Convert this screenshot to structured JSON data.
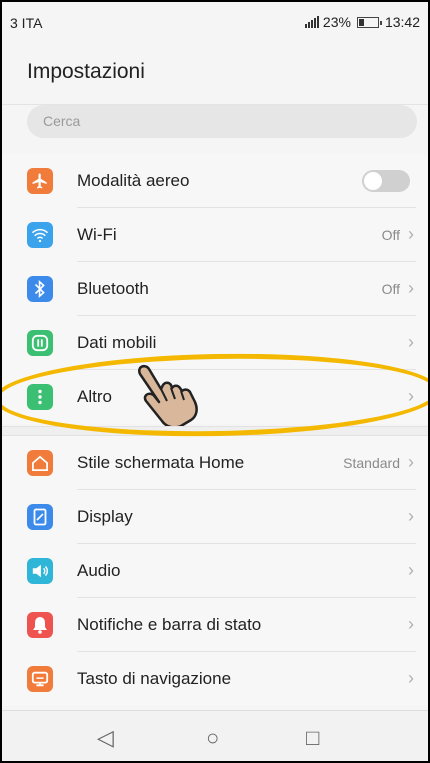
{
  "status_bar": {
    "carrier": "3 ITA",
    "battery": "23%",
    "time": "13:42"
  },
  "header": {
    "title": "Impostazioni"
  },
  "search": {
    "placeholder": "Cerca"
  },
  "groups": [
    {
      "items": [
        {
          "label": "Modalità aereo",
          "icon": "airplane-icon",
          "color": "#f07b3a",
          "control": "toggle",
          "toggle_on": false
        },
        {
          "label": "Wi-Fi",
          "icon": "wifi-icon",
          "color": "#3aa3ec",
          "value": "Off"
        },
        {
          "label": "Bluetooth",
          "icon": "bluetooth-icon",
          "color": "#3c8bea",
          "value": "Off"
        },
        {
          "label": "Dati mobili",
          "icon": "mobile-data-icon",
          "color": "#3bbf72",
          "value": ""
        },
        {
          "label": "Altro",
          "icon": "more-icon",
          "color": "#3bbf72",
          "value": ""
        }
      ]
    },
    {
      "items": [
        {
          "label": "Stile schermata Home",
          "icon": "home-icon",
          "color": "#f07b3a",
          "value": "Standard"
        },
        {
          "label": "Display",
          "icon": "display-icon",
          "color": "#3c8bea",
          "value": ""
        },
        {
          "label": "Audio",
          "icon": "audio-icon",
          "color": "#2fb5d8",
          "value": ""
        },
        {
          "label": "Notifiche e barra di stato",
          "icon": "notification-icon",
          "color": "#ef5350",
          "value": ""
        },
        {
          "label": "Tasto di navigazione",
          "icon": "navigation-key-icon",
          "color": "#f07b3a",
          "value": ""
        }
      ]
    }
  ],
  "annotation": {
    "highlight_color": "#f4b800",
    "pointer": "hand-pointer-icon"
  }
}
